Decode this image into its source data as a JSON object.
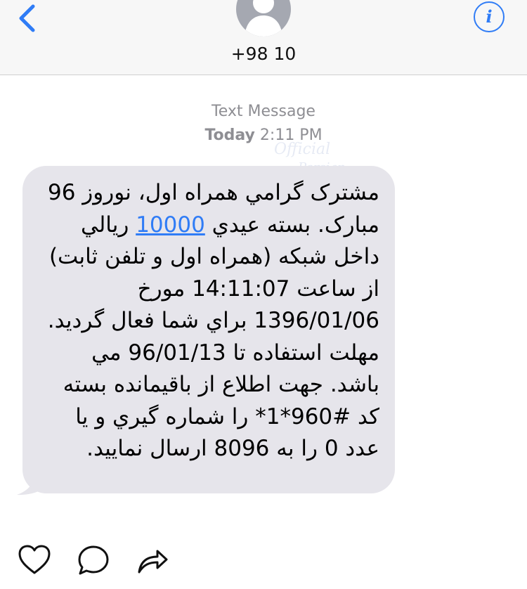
{
  "header": {
    "contact": "+98 10",
    "back_icon": "chevron-left-icon",
    "info_icon": "info-icon",
    "info_glyph": "i",
    "accent_color": "#2f7cf6"
  },
  "thread": {
    "service": "Text Message",
    "day": "Today",
    "time": "2:11 PM",
    "watermark_line1": "Official",
    "watermark_line2": "Persian"
  },
  "message": {
    "before_link": "مشترک گرامي همراه اول، نوروز 96 مبارک. بسته عيدي ",
    "link": "10000",
    "after_link": " ريالي داخل شبکه (همراه اول و تلفن ثابت) از ساعت 14:11:07 مورخ 1396/01/06 براي شما فعال گرديد. مهلت استفاده تا 96/01/13 مي باشد. جهت اطلاع از باقيمانده بسته کد #960*1* را شماره گيري و يا عدد 0 را به 8096 ارسال نماييد.",
    "bubble_color": "#e6e5eb"
  },
  "actions": {
    "like_icon": "heart-icon",
    "comment_icon": "comment-icon",
    "share_icon": "share-icon"
  }
}
